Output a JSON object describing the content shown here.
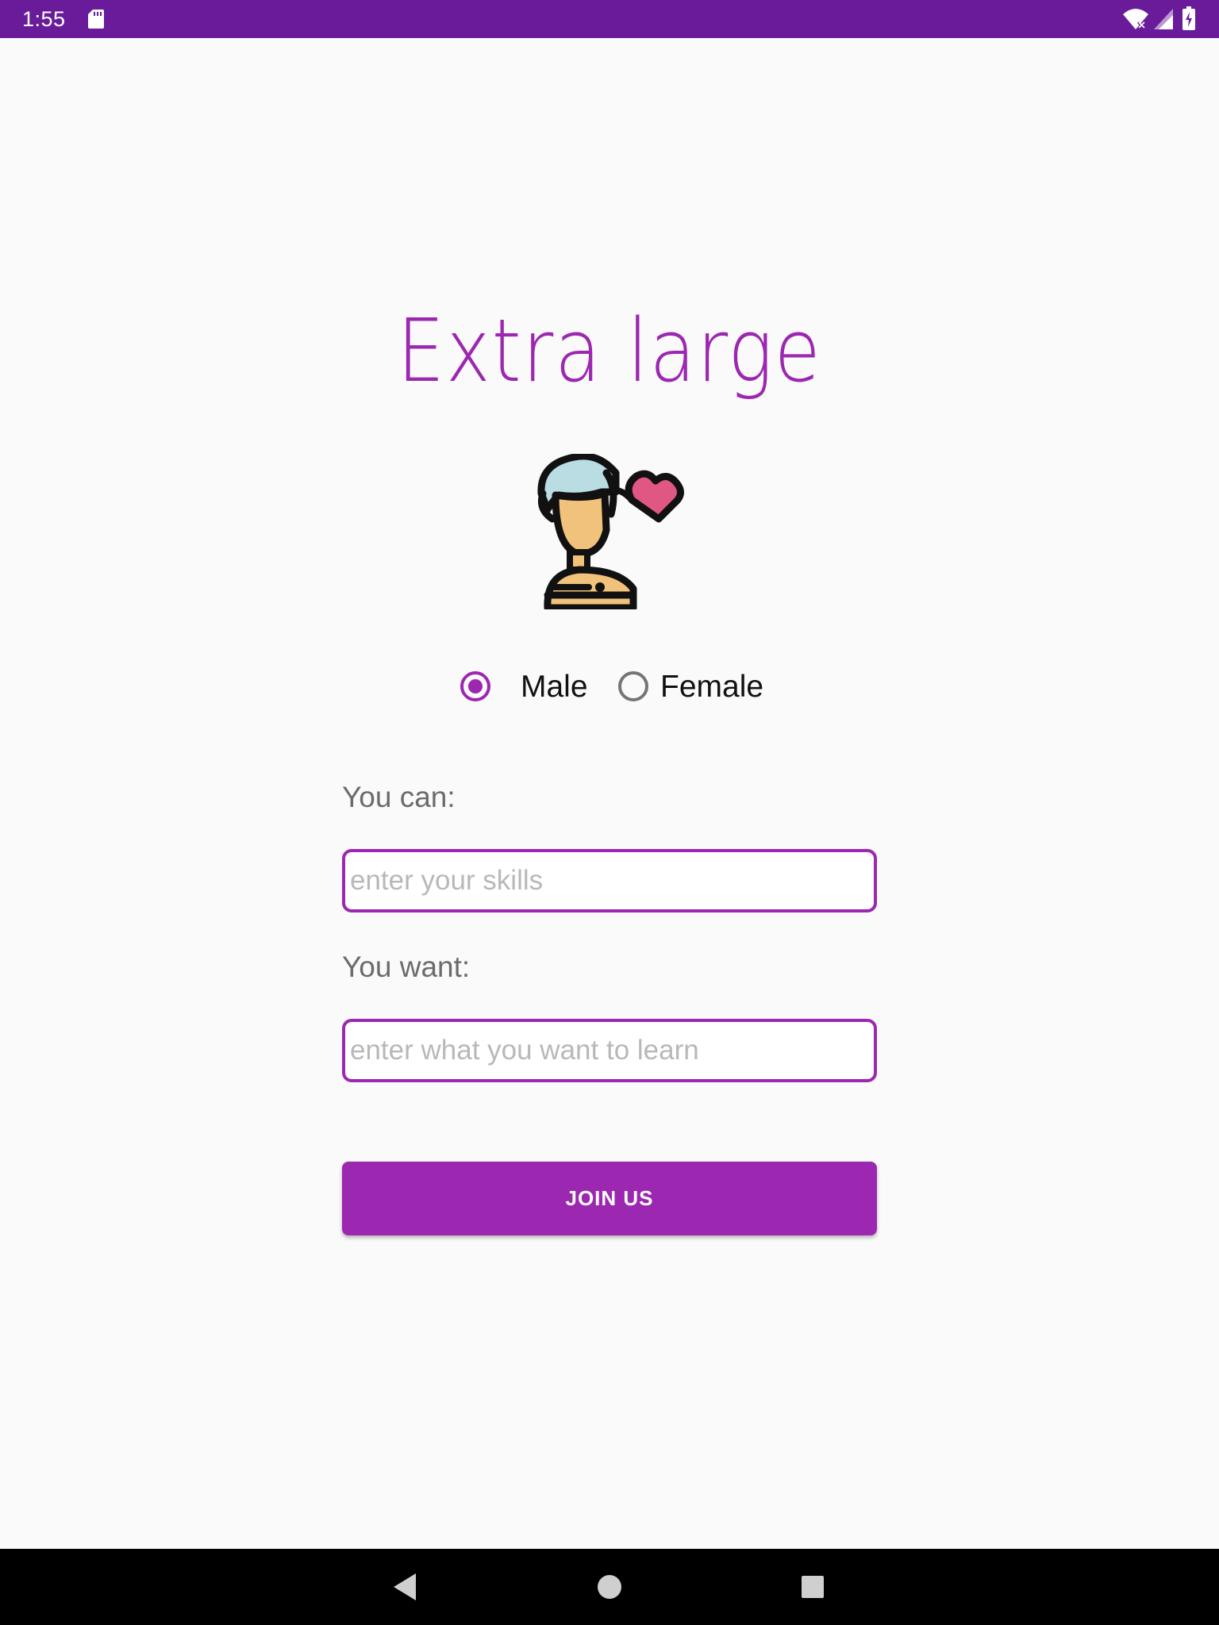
{
  "status_bar": {
    "time": "1:55",
    "background_color": "#6a1b9a",
    "icons": [
      "sd-card-icon",
      "wifi-icon",
      "signal-icon",
      "battery-icon"
    ]
  },
  "header": {
    "title": "Extra large",
    "title_color": "#9c27b0"
  },
  "avatar": {
    "icon": "person-with-heart-icon"
  },
  "gender": {
    "options": [
      {
        "label": "Male",
        "selected": true
      },
      {
        "label": "Female",
        "selected": false
      }
    ]
  },
  "form": {
    "skills_label": "You can:",
    "skills_value": "",
    "skills_placeholder": "enter your skills",
    "want_label": "You want:",
    "want_value": "",
    "want_placeholder": "enter what you want to learn",
    "submit_label": "JOIN US",
    "accent_color": "#9c27b0"
  },
  "nav_bar": {
    "icons": [
      "back-icon",
      "home-icon",
      "recents-icon"
    ]
  }
}
